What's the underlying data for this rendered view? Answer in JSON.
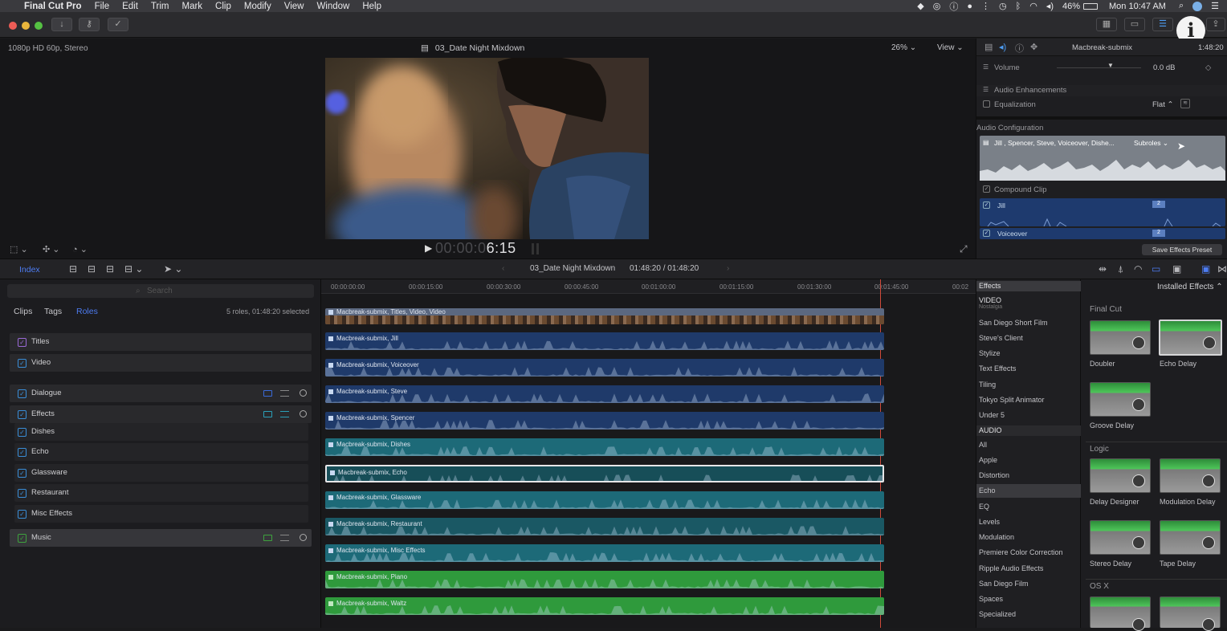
{
  "menubar": {
    "app": "Final Cut Pro",
    "items": [
      "File",
      "Edit",
      "Trim",
      "Mark",
      "Clip",
      "Modify",
      "View",
      "Window",
      "Help"
    ],
    "battery": "46%",
    "clock": "Mon 10:47 AM"
  },
  "viewer": {
    "format": "1080p HD 60p, Stereo",
    "title": "03_Date Night Mixdown",
    "zoom": "26%",
    "view_label": "View",
    "timecode_dim": "00:00:0",
    "timecode_bright": "6:15"
  },
  "inspector": {
    "clip_name": "Macbreak-submix",
    "duration": "1:48:20",
    "volume_label": "Volume",
    "volume_value": "0.0 dB",
    "enhancements_label": "Audio Enhancements",
    "eq_label": "Equalization",
    "eq_value": "Flat",
    "config_label": "Audio Configuration",
    "config_roles": "Jill , Spencer, Steve, Voiceover, Dishe...",
    "subroles_label": "Subroles",
    "compound_label": "Compound Clip",
    "channels": [
      {
        "name": "Jill",
        "badge": "2"
      },
      {
        "name": "Voiceover",
        "badge": "2"
      }
    ],
    "save_preset": "Save Effects Preset"
  },
  "timeline_bar": {
    "index_label": "Index",
    "project": "03_Date Night Mixdown",
    "timecode": "01:48:20 / 01:48:20"
  },
  "index": {
    "search_placeholder": "Search",
    "tabs": [
      "Clips",
      "Tags",
      "Roles"
    ],
    "summary": "5 roles, 01:48:20 selected",
    "roles": [
      {
        "name": "Titles",
        "checked": true
      },
      {
        "name": "Video",
        "checked": true
      },
      {
        "name": "Dialogue",
        "checked": true
      },
      {
        "name": "Effects",
        "checked": true
      },
      {
        "name": "Dishes",
        "checked": true
      },
      {
        "name": "Echo",
        "checked": true
      },
      {
        "name": "Glassware",
        "checked": true
      },
      {
        "name": "Restaurant",
        "checked": true
      },
      {
        "name": "Misc Effects",
        "checked": true
      },
      {
        "name": "Music",
        "checked": true
      }
    ]
  },
  "ruler": [
    "00:00:00:00",
    "00:00:15:00",
    "00:00:30:00",
    "00:00:45:00",
    "00:01:00:00",
    "00:01:15:00",
    "00:01:30:00",
    "00:01:45:00",
    "00:02"
  ],
  "clips": [
    {
      "label": "Macbreak-submix, Titles, Video, Video",
      "color": "#5b6880"
    },
    {
      "label": "Macbreak-submix, Jill",
      "color": "#1f3a6a"
    },
    {
      "label": "Macbreak-submix, Voiceover",
      "color": "#1f3a6a"
    },
    {
      "label": "Macbreak-submix, Steve",
      "color": "#1f3a6a"
    },
    {
      "label": "Macbreak-submix, Spencer",
      "color": "#1f3a6a"
    },
    {
      "label": "Macbreak-submix, Dishes",
      "color": "#1d6a78"
    },
    {
      "label": "Macbreak-submix, Echo",
      "color": "#174e58"
    },
    {
      "label": "Macbreak-submix, Glassware",
      "color": "#1d6a78"
    },
    {
      "label": "Macbreak-submix, Restaurant",
      "color": "#1a5864"
    },
    {
      "label": "Macbreak-submix, Misc Effects",
      "color": "#1d6a78"
    },
    {
      "label": "Macbreak-submix, Piano",
      "color": "#2f9a3c"
    },
    {
      "label": "Macbreak-submix, Waltz",
      "color": "#2f9a3c"
    }
  ],
  "effects": {
    "header": "Effects",
    "installed": "Installed Effects",
    "video_header": "VIDEO",
    "video_cats": [
      "Nostalgia",
      "San Diego Short Film",
      "Steve's Client",
      "Stylize",
      "Text Effects",
      "Tiling",
      "Tokyo Split Animator",
      "Under 5"
    ],
    "audio_header": "AUDIO",
    "audio_cats": [
      "All",
      "Apple",
      "Distortion",
      "Echo",
      "EQ",
      "Levels",
      "Modulation",
      "Premiere Color Correction",
      "Ripple Audio Effects",
      "San Diego Film",
      "Spaces",
      "Specialized"
    ],
    "sections": [
      {
        "title": "Final Cut",
        "items": [
          "Doubler",
          "Echo Delay",
          "Groove Delay"
        ]
      },
      {
        "title": "Logic",
        "items": [
          "Delay Designer",
          "Modulation Delay",
          "Stereo Delay",
          "Tape Delay"
        ]
      },
      {
        "title": "OS X",
        "items": []
      }
    ]
  },
  "colors": {
    "accent_blue": "#3a8ed8",
    "audio_blue": "#1f3a6a",
    "effects_teal": "#1d6a78",
    "music_green": "#2f9a3c"
  }
}
